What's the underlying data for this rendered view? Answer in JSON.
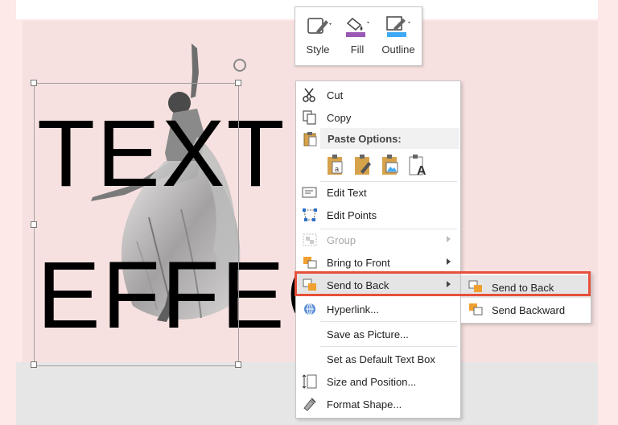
{
  "slide": {
    "text_line1": "TEXT",
    "text_line2": "EFFEC"
  },
  "mini_toolbar": {
    "items": [
      {
        "label": "Style",
        "icon": "style-icon"
      },
      {
        "label": "Fill",
        "icon": "fill-bucket-icon"
      },
      {
        "label": "Outline",
        "icon": "outline-pen-icon"
      }
    ]
  },
  "context_menu": {
    "cut": "Cut",
    "copy": "Copy",
    "paste_options": "Paste Options:",
    "edit_text": "Edit Text",
    "edit_points": "Edit Points",
    "group": "Group",
    "bring_to_front": "Bring to Front",
    "send_to_back": "Send to Back",
    "hyperlink": "Hyperlink...",
    "save_as_picture": "Save as Picture...",
    "set_default_text_box": "Set as Default Text Box",
    "size_and_position": "Size and Position...",
    "format_shape": "Format Shape..."
  },
  "submenu": {
    "send_to_back": "Send to Back",
    "send_backward": "Send Backward"
  },
  "colors": {
    "fill_accent": "#9b59b6",
    "outline_accent": "#3fa9f5",
    "highlight_red": "#e8503a"
  }
}
